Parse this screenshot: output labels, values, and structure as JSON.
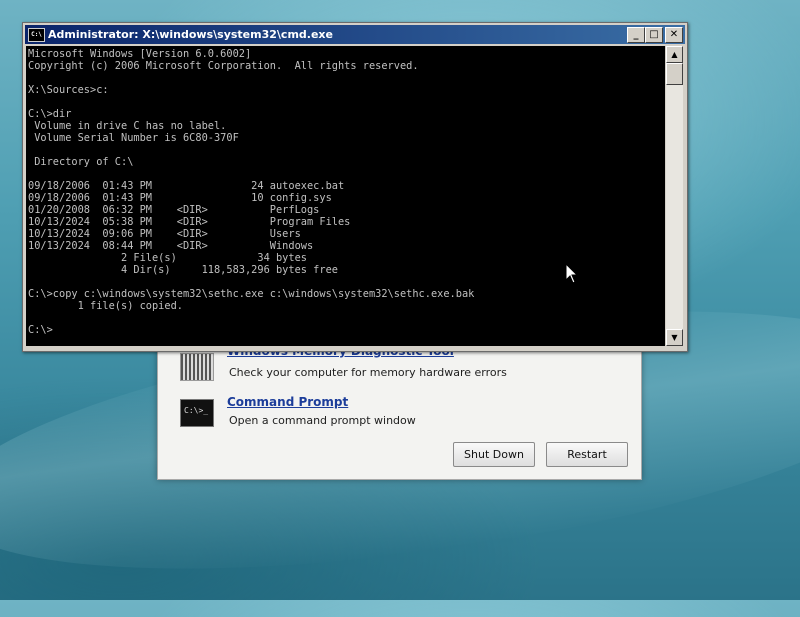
{
  "cmd_window": {
    "title": "Administrator: X:\\windows\\system32\\cmd.exe",
    "icon_text": "C:\\",
    "minimize": "_",
    "maximize": "□",
    "close": "✕",
    "console_text": "Microsoft Windows [Version 6.0.6002]\nCopyright (c) 2006 Microsoft Corporation.  All rights reserved.\n\nX:\\Sources>c:\n\nC:\\>dir\n Volume in drive C has no label.\n Volume Serial Number is 6C80-370F\n\n Directory of C:\\\n\n09/18/2006  01:43 PM                24 autoexec.bat\n09/18/2006  01:43 PM                10 config.sys\n01/20/2008  06:32 PM    <DIR>          PerfLogs\n10/13/2024  05:38 PM    <DIR>          Program Files\n10/13/2024  09:06 PM    <DIR>          Users\n10/13/2024  08:44 PM    <DIR>          Windows\n               2 File(s)             34 bytes\n               4 Dir(s)     118,583,296 bytes free\n\nC:\\>copy c:\\windows\\system32\\sethc.exe c:\\windows\\system32\\sethc.exe.bak\n        1 file(s) copied.\n\nC:\\>"
  },
  "recovery_dialog": {
    "items": [
      {
        "title": "Windows Memory Diagnostic Tool",
        "description": "Check your computer for memory hardware errors",
        "icon": "memory-chip-icon"
      },
      {
        "title": "Command Prompt",
        "description": "Open a command prompt window",
        "icon": "command-prompt-icon",
        "icon_text": "C:\\>_"
      }
    ],
    "shutdown_label": "Shut Down",
    "restart_label": "Restart"
  }
}
